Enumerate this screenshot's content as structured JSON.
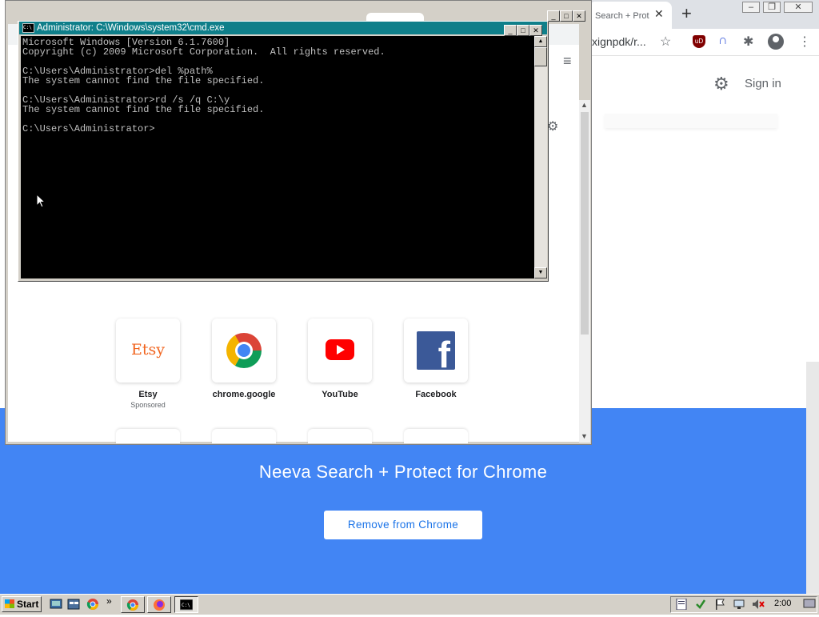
{
  "background_browser": {
    "tab_title": "Search + Prot",
    "url_fragment": "xignpdk/r...",
    "signin_label": "Sign in",
    "ublock_badge": "uD"
  },
  "browser_window": {
    "shortcuts": [
      {
        "name": "Etsy",
        "subtitle": "Sponsored",
        "logo_text": "Etsy"
      },
      {
        "name": "chrome.google",
        "subtitle": ""
      },
      {
        "name": "YouTube",
        "subtitle": ""
      },
      {
        "name": "Facebook",
        "subtitle": "",
        "logo_text": "f"
      }
    ]
  },
  "banner": {
    "title": "Neeva Search + Protect for Chrome",
    "button_label": "Remove from Chrome",
    "background_color": "#4285f4"
  },
  "cmd": {
    "title": "Administrator: C:\\Windows\\system32\\cmd.exe",
    "icon_text": "C:\\",
    "lines": [
      "Microsoft Windows [Version 6.1.7600]",
      "Copyright (c) 2009 Microsoft Corporation.  All rights reserved.",
      "",
      "C:\\Users\\Administrator>del %path%",
      "The system cannot find the file specified.",
      "",
      "C:\\Users\\Administrator>rd /s /q C:\\y",
      "The system cannot find the file specified.",
      "",
      "C:\\Users\\Administrator>"
    ]
  },
  "taskbar": {
    "start_label": "Start",
    "clock": "2:00",
    "overflow": "»"
  }
}
